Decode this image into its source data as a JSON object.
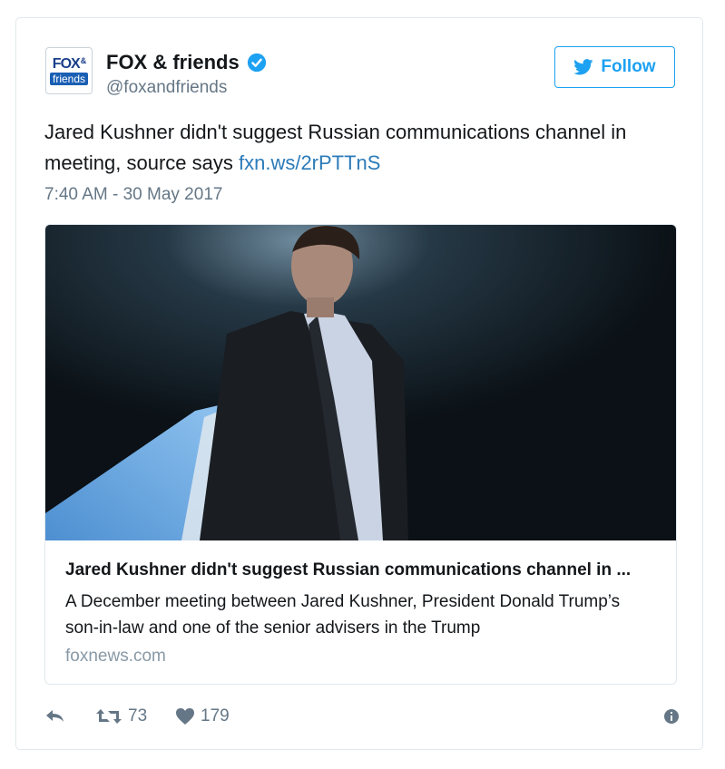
{
  "author": {
    "name": "FOX & friends",
    "handle": "@foxandfriends",
    "avatar_text_top": "FOX",
    "avatar_text_amp": "&",
    "avatar_text_bottom": "friends",
    "verified_icon": "verified-badge-icon"
  },
  "follow_button": {
    "label": "Follow",
    "icon": "twitter-bird-icon"
  },
  "tweet": {
    "text": "Jared Kushner didn't suggest Russian communications channel in meeting, source says ",
    "link": "fxn.ws/2rPTTnS",
    "timestamp": "7:40 AM - 30 May 2017"
  },
  "card": {
    "image_icon": "photo-man-in-suit-beside-airplane",
    "title": "Jared Kushner didn't suggest Russian communications channel in ...",
    "description": "A December meeting between Jared Kushner, President Donald Trump’s son-in-law and one of the senior advisers in the Trump",
    "domain": "foxnews.com"
  },
  "actions": {
    "reply_icon": "reply-icon",
    "retweet_icon": "retweet-icon",
    "retweet_count": "73",
    "like_icon": "heart-icon",
    "like_count": "179",
    "info_icon": "info-icon"
  },
  "colors": {
    "link": "#2b7bb9",
    "follow_blue": "#1da1f2",
    "secondary_text": "#657786",
    "border": "#e1e8ed"
  }
}
